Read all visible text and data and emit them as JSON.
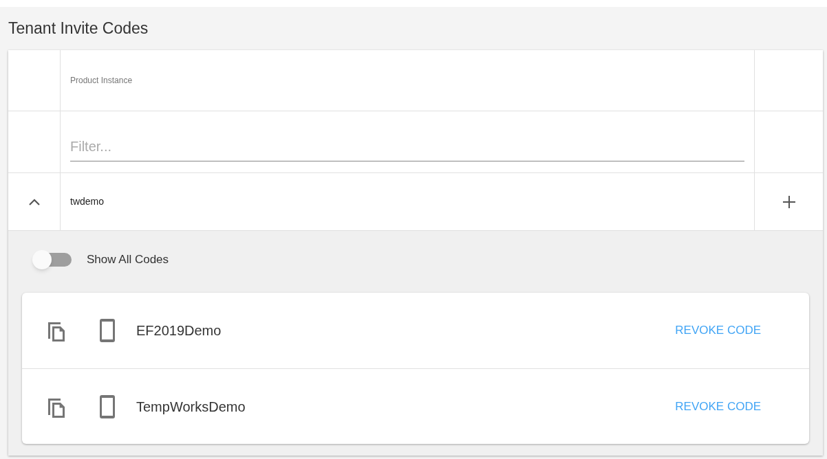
{
  "title": "Tenant Invite Codes",
  "table": {
    "column_header": "Product Instance",
    "filter": {
      "placeholder": "Filter..."
    },
    "groups": [
      {
        "name": "twdemo",
        "expanded": true,
        "show_all_codes": {
          "label": "Show All Codes",
          "on": false
        },
        "codes": [
          {
            "name": "EF2019Demo",
            "action": "REVOKE CODE"
          },
          {
            "name": "TempWorksDemo",
            "action": "REVOKE CODE"
          }
        ]
      }
    ]
  }
}
